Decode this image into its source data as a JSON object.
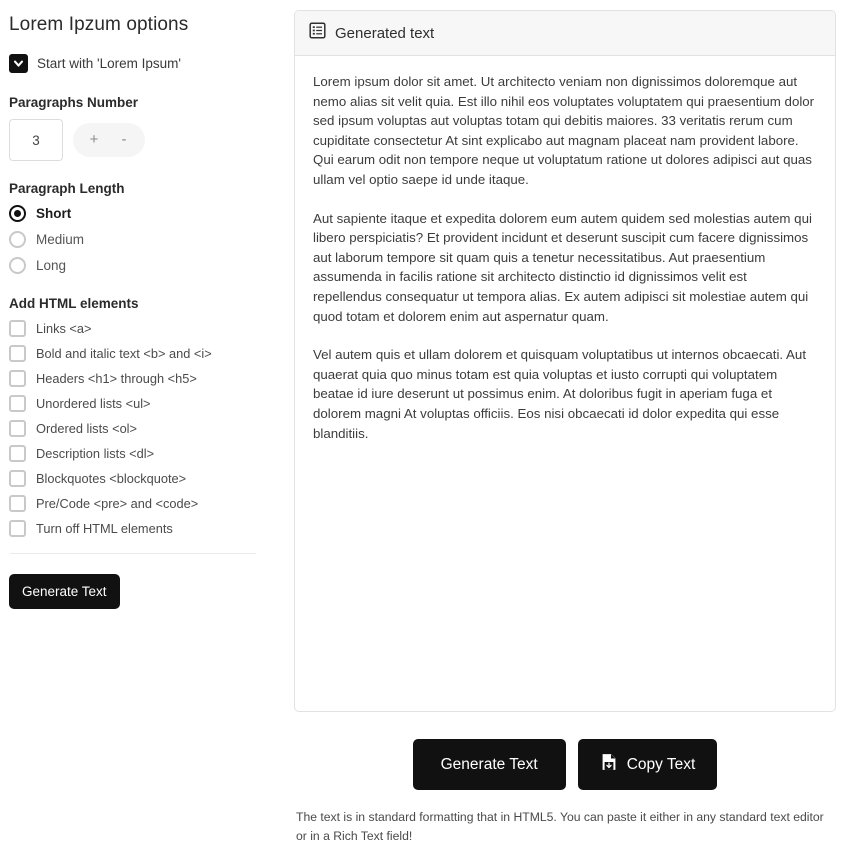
{
  "options": {
    "title": "Lorem Ipzum options",
    "start_checkbox": {
      "label": "Start with 'Lorem Ipsum'",
      "checked": true,
      "icon": "chevron-down-icon"
    },
    "paragraphs_number": {
      "label": "Paragraphs Number",
      "value": "3",
      "increment_label": "+",
      "decrement_label": "-"
    },
    "paragraph_length": {
      "label": "Paragraph Length",
      "selected": "Short",
      "items": [
        {
          "label": "Short",
          "selected": true
        },
        {
          "label": "Medium",
          "selected": false
        },
        {
          "label": "Long",
          "selected": false
        }
      ]
    },
    "html_elements": {
      "label": "Add HTML elements",
      "items": [
        {
          "label": "Links <a>",
          "checked": false
        },
        {
          "label": "Bold and italic text <b> and <i>",
          "checked": false
        },
        {
          "label": "Headers <h1> through <h5>",
          "checked": false
        },
        {
          "label": "Unordered lists <ul>",
          "checked": false
        },
        {
          "label": "Ordered lists <ol>",
          "checked": false
        },
        {
          "label": "Description lists <dl>",
          "checked": false
        },
        {
          "label": "Blockquotes <blockquote>",
          "checked": false
        },
        {
          "label": "Pre/Code <pre> and <code>",
          "checked": false
        },
        {
          "label": "Turn off HTML elements",
          "checked": false
        }
      ]
    },
    "generate_button_label": "Generate Text"
  },
  "output": {
    "header_title": "Generated text",
    "header_icon": "document-list-icon",
    "paragraphs": [
      "Lorem ipsum dolor sit amet. Ut architecto veniam non dignissimos doloremque aut nemo alias sit velit quia. Est illo nihil eos voluptates voluptatem qui praesentium dolor sed ipsum voluptas aut voluptas totam qui debitis maiores. 33 veritatis rerum cum cupiditate consectetur At sint explicabo aut magnam placeat nam provident labore. Qui earum odit non tempore neque ut voluptatum ratione ut dolores adipisci aut quas ullam vel optio saepe id unde itaque.",
      "Aut sapiente itaque et expedita dolorem eum autem quidem sed molestias autem qui libero perspiciatis? Et provident incidunt et deserunt suscipit cum facere dignissimos aut laborum tempore sit quam quis a tenetur necessitatibus. Aut praesentium assumenda in facilis ratione sit architecto distinctio id dignissimos velit est repellendus consequatur ut tempora alias. Ex autem adipisci sit molestiae autem qui quod totam et dolorem enim aut aspernatur quam.",
      "Vel autem quis et ullam dolorem et quisquam voluptatibus ut internos obcaecati. Aut quaerat quia quo minus totam est quia voluptas et iusto corrupti qui voluptatem beatae id iure deserunt ut possimus enim. At doloribus fugit in aperiam fuga et dolorem magni At voluptas officiis. Eos nisi obcaecati id dolor expedita qui esse blanditiis."
    ]
  },
  "actions": {
    "generate_label": "Generate Text",
    "copy_label": "Copy Text",
    "copy_icon": "file-download-icon"
  },
  "footer": {
    "note": "The text is in standard formatting that in HTML5. You can paste it either in any standard text editor or in a Rich Text field!"
  },
  "colors": {
    "button_dark": "#111111",
    "card_header_bg": "#f7f7f7",
    "border": "#e2e2e2",
    "control_border": "#c9c9c9"
  }
}
